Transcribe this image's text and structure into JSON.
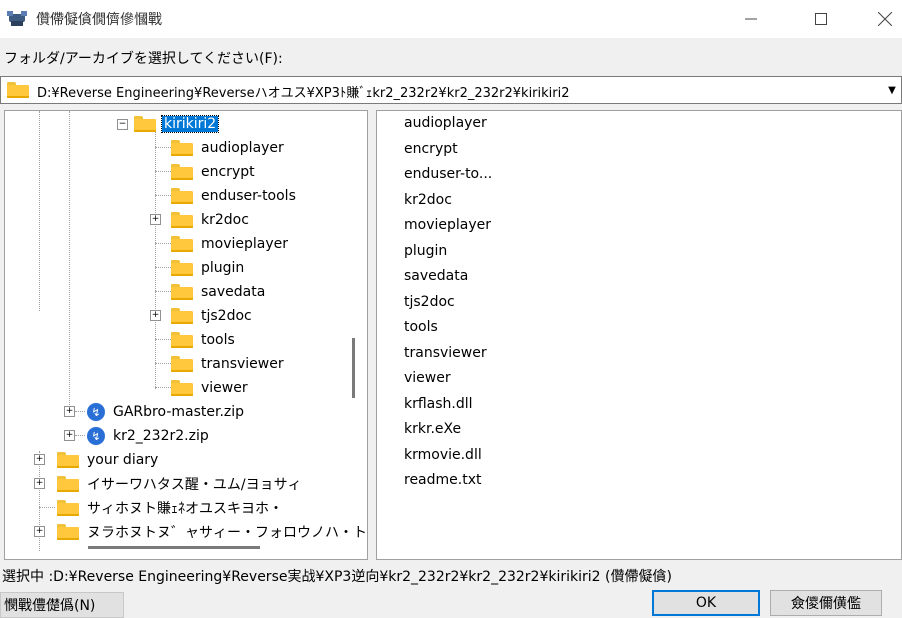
{
  "window": {
    "title": "儹僀儗僋僩儕傪慖戰",
    "icon": "app-icon",
    "minimize_icon": "—",
    "maximize_icon": "☐",
    "close_icon": "✕"
  },
  "prompt": {
    "label": "フォルダ/アーカイブを選択してください(F):"
  },
  "path_field": {
    "value": "D:¥Reverse Engineering¥Reverseハオユス¥XP3ﾄ賺ﾞｪkr2_232r2¥kr2_232r2¥kirikiri2",
    "dropdown_icon": "▼"
  },
  "tree": {
    "nodes": [
      {
        "label": "kirikiri2",
        "type": "folder",
        "selected": true,
        "expander": "−"
      },
      {
        "label": "audioplayer",
        "type": "folder"
      },
      {
        "label": "encrypt",
        "type": "folder"
      },
      {
        "label": "enduser-tools",
        "type": "folder"
      },
      {
        "label": "kr2doc",
        "type": "folder",
        "expander": "+"
      },
      {
        "label": "movieplayer",
        "type": "folder"
      },
      {
        "label": "plugin",
        "type": "folder"
      },
      {
        "label": "savedata",
        "type": "folder"
      },
      {
        "label": "tjs2doc",
        "type": "folder",
        "expander": "+"
      },
      {
        "label": "tools",
        "type": "folder"
      },
      {
        "label": "transviewer",
        "type": "folder"
      },
      {
        "label": "viewer",
        "type": "folder"
      },
      {
        "label": "GARbro-master.zip",
        "type": "zip",
        "expander": "+"
      },
      {
        "label": "kr2_232r2.zip",
        "type": "zip",
        "expander": "+"
      },
      {
        "label": "your diary",
        "type": "folder",
        "expander": "+"
      },
      {
        "label": "イサーワハタス醒・ユム/ヨョサィ",
        "type": "folder",
        "expander": "+"
      },
      {
        "label": "サィホヌト賺ｪﾈオユスキヨホ・",
        "type": "folder"
      },
      {
        "label": "ヌラホヌトヌ゛ャサィー・フォロウノハ・トネレサッ",
        "type": "folder",
        "expander": "+"
      }
    ]
  },
  "list": {
    "items": [
      "audioplayer",
      "encrypt",
      "enduser-to...",
      "kr2doc",
      "movieplayer",
      "plugin",
      "savedata",
      "tjs2doc",
      "tools",
      "transviewer",
      "viewer",
      "krflash.dll",
      "krkr.eXe",
      "krmovie.dll",
      "readme.txt"
    ]
  },
  "status": {
    "text": "選択中 :D:¥Reverse Engineering¥Reverse実战¥XP3逆向¥kr2_232r2¥kr2_232r2¥kirikiri2 (儹僀儗僋)"
  },
  "buttons": {
    "new_folder": "憫戰僼儊僞(N)",
    "ok": "OK",
    "cancel": "僉儍儞僙儖"
  },
  "colors": {
    "selection": "#0078d7",
    "folder": "#ffc83d",
    "zip": "#2a6fd6"
  }
}
